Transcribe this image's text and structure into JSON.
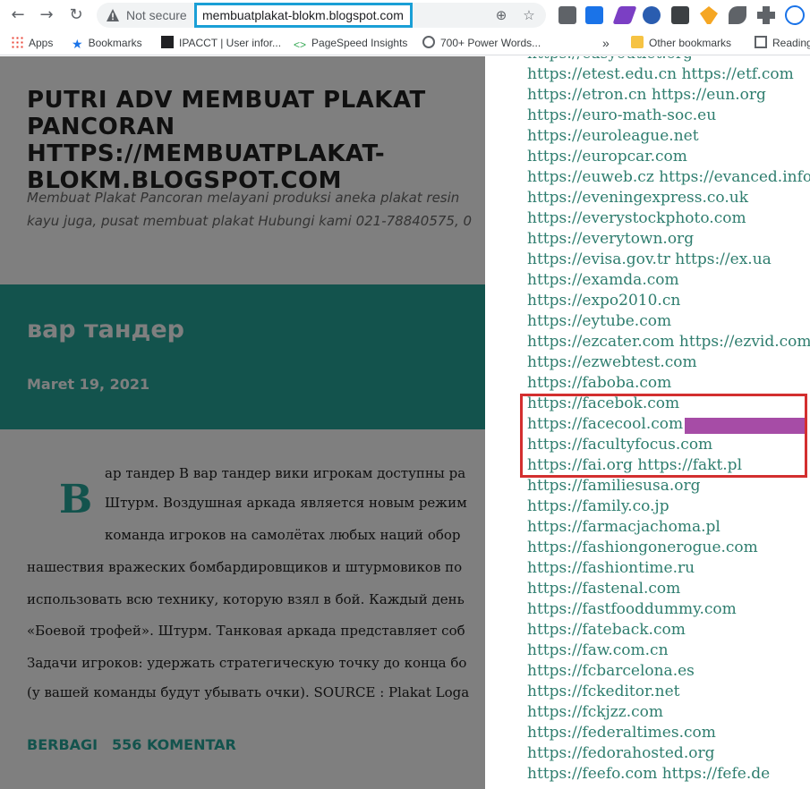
{
  "browser": {
    "not_secure_label": "Not secure",
    "address": "membuatplakat-blokm.blogspot.com",
    "bookmarks": [
      {
        "label": "Apps",
        "icon": "apps-grid-icon"
      },
      {
        "label": "Bookmarks",
        "icon": "star-icon"
      },
      {
        "label": "IPACCT | User infor...",
        "icon": "ipacct-logo-icon"
      },
      {
        "label": "PageSpeed Insights",
        "icon": "pagespeed-icon"
      },
      {
        "label": "700+ Power Words...",
        "icon": "globe-icon"
      }
    ],
    "overflow_label": "»",
    "other_bookmarks": "Other bookmarks",
    "reading_list": "Reading"
  },
  "blog": {
    "title": "PUTRI ADV MEMBUAT PLAKAT PANCORAN HTTPS://MEMBUATPLAKAT-BLOKM.BLOGSPOT.COM",
    "description_lines": [
      "Membuat Plakat Pancoran melayani produksi aneka plakat resin",
      "kayu juga, pusat membuat plakat Hubungi kami 021-78840575, 0"
    ],
    "post_title": "вар тандер",
    "post_date": "Maret 19, 2021",
    "dropcap": "В",
    "body_lines": [
      "ар тандер В вар тандер вики игрокам доступны ра",
      "Штурм. Воздушная аркада является новым режим",
      "команда игроков на самолётах любых наций обор",
      "нашествия вражеских бомбардировщиков и штурмовиков по",
      "использовать всю технику, которую взял в бой. Каждый день",
      "«Боевой трофей». Штурм. Танковая аркада представляет соб",
      "Задачи игроков: удержать стратегическую точку до конца бо",
      "(у вашей команды будут убывать очки). SOURCE : Plakat Loga"
    ],
    "share_label": "BERBAGI",
    "comments_label": "556 KOMENTAR"
  },
  "url_list": [
    "https://easyoutlet.org",
    "https://etest.edu.cn https://etf.com",
    "https://etron.cn https://eun.org",
    "https://euro-math-soc.eu",
    "https://euroleague.net",
    "https://europcar.com",
    "https://euweb.cz https://evanced.info",
    "https://eveningexpress.co.uk",
    "https://everystockphoto.com",
    "https://everytown.org",
    "https://evisa.gov.tr https://ex.ua",
    "https://examda.com",
    "https://expo2010.cn",
    "https://eytube.com",
    "https://ezcater.com https://ezvid.com",
    "https://ezwebtest.com",
    "https://faboba.com",
    "https://facebok.com",
    "https://facecool.com",
    "https://facultyfocus.com",
    "https://fai.org https://fakt.pl",
    "https://familiesusa.org",
    "https://family.co.jp",
    "https://farmacjachoma.pl",
    "https://fashiongonerogue.com",
    "https://fashiontime.ru",
    "https://fastenal.com",
    "https://fastfooddummy.com",
    "https://fateback.com",
    "https://faw.com.cn",
    "https://fcbarcelona.es",
    "https://fckeditor.net",
    "https://fckjzz.com",
    "https://federaltimes.com",
    "https://fedorahosted.org",
    "https://feefo.com https://fefe.de"
  ],
  "colors": {
    "accent_teal": "#26a69a",
    "link_green": "#2e7d6e",
    "highlight_red": "#d32f2f",
    "redaction_purple": "#a64ca6",
    "url_box_blue": "#1a9fd6"
  }
}
